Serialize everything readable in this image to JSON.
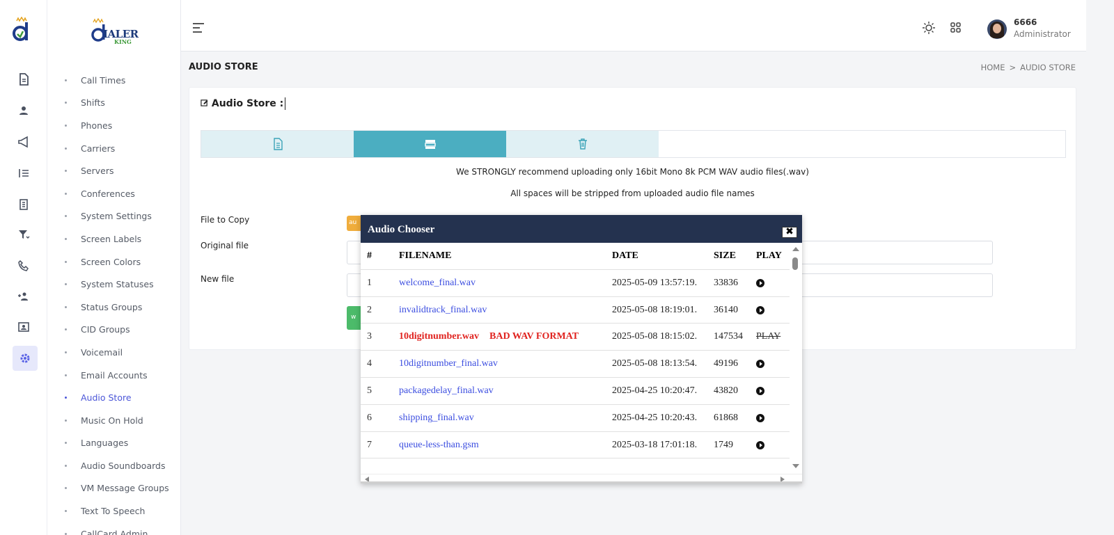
{
  "brand": {
    "name": "IALER",
    "sub": "KING"
  },
  "submenu": [
    {
      "label": "Call Times"
    },
    {
      "label": "Shifts"
    },
    {
      "label": "Phones"
    },
    {
      "label": "Carriers"
    },
    {
      "label": "Servers"
    },
    {
      "label": "Conferences"
    },
    {
      "label": "System Settings"
    },
    {
      "label": "Screen Labels"
    },
    {
      "label": "Screen Colors"
    },
    {
      "label": "System Statuses"
    },
    {
      "label": "Status Groups"
    },
    {
      "label": "CID Groups"
    },
    {
      "label": "Voicemail"
    },
    {
      "label": "Email Accounts"
    },
    {
      "label": "Audio Store",
      "active": true
    },
    {
      "label": "Music On Hold"
    },
    {
      "label": "Languages"
    },
    {
      "label": "Audio Soundboards"
    },
    {
      "label": "VM Message Groups"
    },
    {
      "label": "Text To Speech"
    },
    {
      "label": "CallCard Admin"
    }
  ],
  "rail_icons": [
    "document-icon",
    "user-icon",
    "megaphone-icon",
    "list-icon",
    "report-icon",
    "filter-icon",
    "phone-icon",
    "add-users-icon",
    "contact-card-icon",
    "settings-gear-icon"
  ],
  "user": {
    "name": "6666",
    "role": "Administrator"
  },
  "page": {
    "title": "AUDIO STORE",
    "breadcrumb": {
      "home": "HOME",
      "sep": ">",
      "current": "AUDIO STORE"
    }
  },
  "card": {
    "title": "Audio Store :",
    "note1": "We STRONGLY recommend uploading only 16bit Mono 8k PCM WAV audio files(.wav)",
    "note2": "All spaces will be stripped from uploaded audio file names",
    "file_to_copy_label": "File to Copy",
    "original_file_label": "Original file",
    "new_file_label": "New file",
    "orange_btn": "au",
    "green_btn": "w"
  },
  "modal": {
    "title": "Audio Chooser",
    "close": "✖",
    "headers": {
      "num": "#",
      "file": "FILENAME",
      "date": "DATE",
      "size": "SIZE",
      "play": "PLAY"
    },
    "rows": [
      {
        "num": "1",
        "file": "welcome_final.wav",
        "date": "2025-05-09 13:57:19.",
        "size": "33836",
        "play": "play"
      },
      {
        "num": "2",
        "file": "invalidtrack_final.wav",
        "date": "2025-05-08 18:19:01.",
        "size": "36140",
        "play": "play"
      },
      {
        "num": "3",
        "file": "10digitnumber.wav",
        "bad": "BAD WAV FORMAT",
        "date": "2025-05-08 18:15:02.",
        "size": "147534",
        "play": "PLAY"
      },
      {
        "num": "4",
        "file": "10digitnumber_final.wav",
        "date": "2025-05-08 18:13:54.",
        "size": "49196",
        "play": "play"
      },
      {
        "num": "5",
        "file": "packagedelay_final.wav",
        "date": "2025-04-25 10:20:47.",
        "size": "43820",
        "play": "play"
      },
      {
        "num": "6",
        "file": "shipping_final.wav",
        "date": "2025-04-25 10:20:43.",
        "size": "61868",
        "play": "play"
      },
      {
        "num": "7",
        "file": "queue-less-than.gsm",
        "date": "2025-03-18 17:01:18.",
        "size": "1749",
        "play": "play"
      }
    ]
  },
  "colors": {
    "accent": "#4b56d8",
    "tab_active": "#4baec1",
    "modal_header": "#24324f",
    "error": "#e0231f"
  }
}
